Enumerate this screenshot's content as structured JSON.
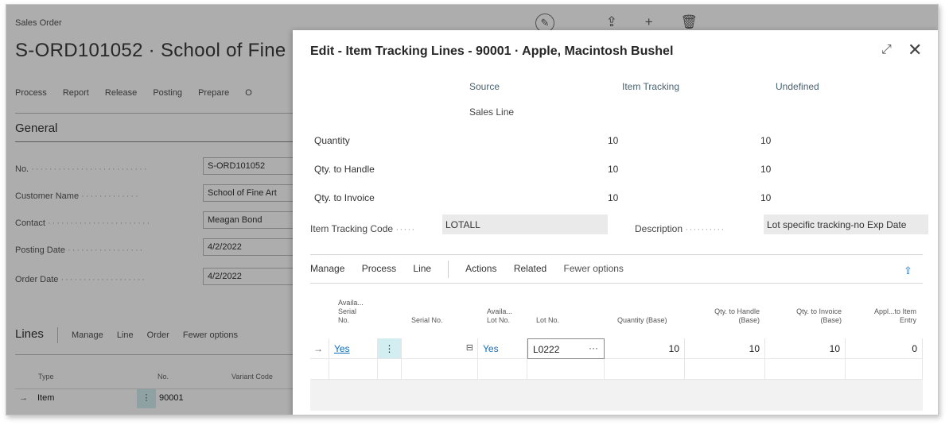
{
  "background": {
    "breadcrumb": "Sales Order",
    "title": "S-ORD101052 · School of Fine",
    "menu": [
      "Process",
      "Report",
      "Release",
      "Posting",
      "Prepare",
      "O"
    ],
    "section": "General",
    "fields": [
      {
        "label": "No.",
        "value": "S-ORD101052"
      },
      {
        "label": "Customer Name",
        "value": "School of Fine Art"
      },
      {
        "label": "Contact",
        "value": "Meagan Bond"
      },
      {
        "label": "Posting Date",
        "value": "4/2/2022"
      },
      {
        "label": "Order Date",
        "value": "4/2/2022"
      }
    ],
    "lines_bar": {
      "title": "Lines",
      "items": [
        "Manage",
        "Line",
        "Order",
        "Fewer options"
      ]
    },
    "grid_headers": {
      "type": "Type",
      "no": "No.",
      "variant": "Variant Code"
    },
    "grid_row": {
      "type": "Item",
      "no": "90001"
    },
    "toolbar_icons": [
      "edit-icon",
      "share-icon",
      "add-icon",
      "delete-icon"
    ]
  },
  "dialog": {
    "title": "Edit - Item Tracking Lines - 90001 · Apple, Macintosh Bushel",
    "columns": {
      "source": "Source",
      "source_sub": "Sales Line",
      "item_tracking": "Item Tracking",
      "undefined": "Undefined"
    },
    "rows": [
      {
        "label": "Quantity",
        "tracking": "10",
        "undefined": "10"
      },
      {
        "label": "Qty. to Handle",
        "tracking": "10",
        "undefined": "10"
      },
      {
        "label": "Qty. to Invoice",
        "tracking": "10",
        "undefined": "10"
      }
    ],
    "item_tracking_code": {
      "label": "Item Tracking Code",
      "value": "LOTALL"
    },
    "description": {
      "label": "Description",
      "value": "Lot specific tracking-no Exp Date"
    },
    "actions": [
      "Manage",
      "Process",
      "Line",
      "Actions",
      "Related",
      "Fewer options"
    ],
    "table_headers": {
      "avail_serial": [
        "Availa...",
        "Serial",
        "No."
      ],
      "serial_no": "Serial No.",
      "avail_lot": [
        "Availa...",
        "Lot No."
      ],
      "lot_no": "Lot No.",
      "quantity_base": "Quantity (Base)",
      "qty_handle": [
        "Qty. to Handle",
        "(Base)"
      ],
      "qty_invoice": [
        "Qty. to Invoice",
        "(Base)"
      ],
      "appl_entry": [
        "Appl...to Item",
        "Entry"
      ]
    },
    "table_row": {
      "avail_serial": "Yes",
      "serial_no": "",
      "avail_lot": "Yes",
      "lot_no": "L0222",
      "quantity_base": "10",
      "qty_handle": "10",
      "qty_invoice": "10",
      "appl_entry": "0"
    }
  }
}
